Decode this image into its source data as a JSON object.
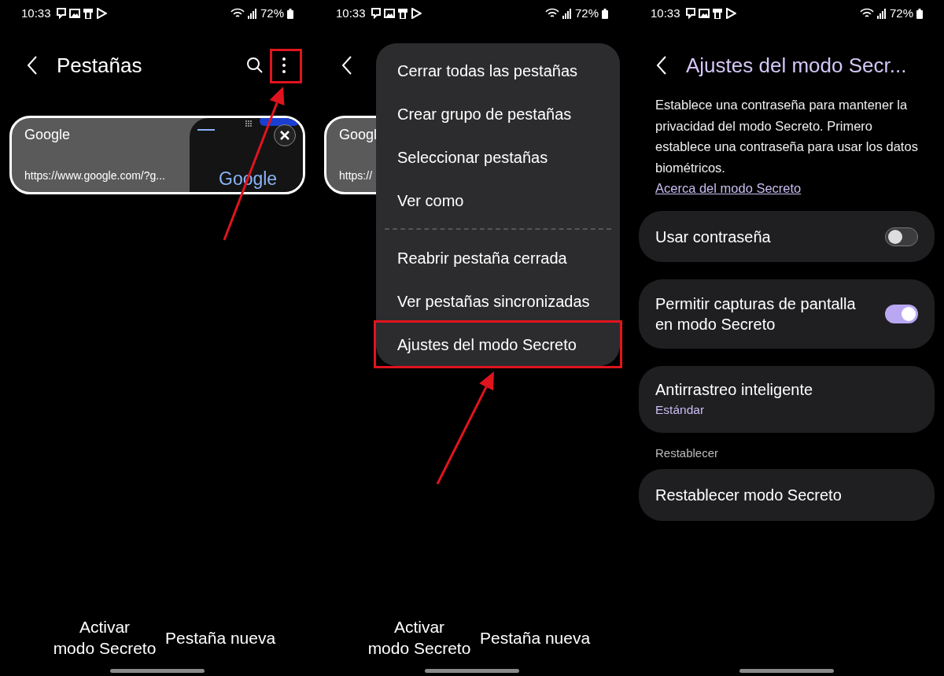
{
  "screens": [
    {
      "status_bar": {
        "time": "10:33",
        "battery": "72%"
      },
      "header": {
        "title": "Pestañas"
      },
      "tab_card": {
        "title": "Google",
        "url": "https://www.google.com/?g...",
        "preview": {
          "logo": "Google"
        }
      },
      "bottom_buttons": [
        "Activar\nmodo Secreto",
        "Pestaña nueva"
      ]
    },
    {
      "status_bar": {
        "time": "10:33",
        "battery": "72%"
      },
      "tab_card": {
        "title": "Googl",
        "url": "https://"
      },
      "menu": {
        "groups": [
          [
            {
              "label": "Cerrar todas las pestañas",
              "highlighted": false
            },
            {
              "label": "Crear grupo de pestañas",
              "highlighted": false
            },
            {
              "label": "Seleccionar pestañas",
              "highlighted": false
            },
            {
              "label": "Ver como",
              "highlighted": false
            }
          ],
          [
            {
              "label": "Reabrir pestaña cerrada",
              "highlighted": false
            },
            {
              "label": "Ver pestañas sincronizadas",
              "highlighted": false
            },
            {
              "label": "Ajustes del modo Secreto",
              "highlighted": true
            }
          ]
        ]
      },
      "bottom_buttons": [
        "Activar\nmodo Secreto",
        "Pestaña nueva"
      ]
    },
    {
      "status_bar": {
        "time": "10:33",
        "battery": "72%"
      },
      "header": {
        "title": "Ajustes del modo Secr..."
      },
      "description": "Establece una contraseña para mantener la privacidad del modo Secreto. Primero establece una contraseña para usar los datos biométricos.",
      "link": "Acerca del modo Secreto",
      "settings": [
        {
          "kind": "toggle",
          "label": "Usar contraseña",
          "on": false
        },
        {
          "kind": "toggle",
          "label": "Permitir capturas de pantalla en modo Secreto",
          "on": true
        },
        {
          "kind": "option",
          "label": "Antirrastreo inteligente",
          "value": "Estándar"
        },
        {
          "kind": "section",
          "label": "Restablecer"
        },
        {
          "kind": "action",
          "label": "Restablecer modo Secreto"
        }
      ]
    }
  ]
}
